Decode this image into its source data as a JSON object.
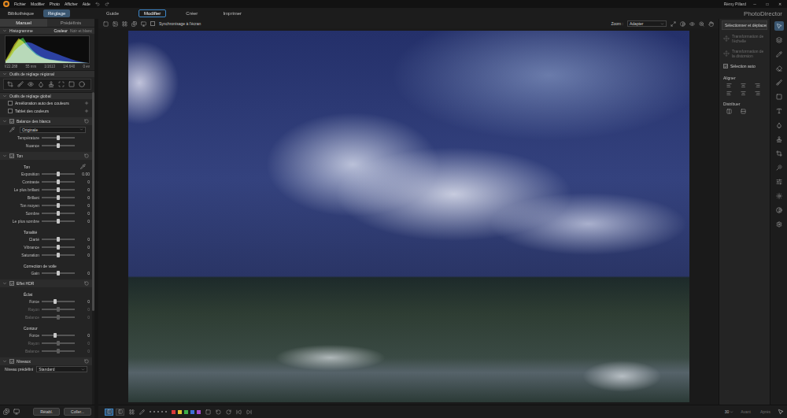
{
  "menu": {
    "items": [
      "Fichier",
      "Modifier",
      "Photo",
      "Afficher",
      "Aide"
    ],
    "user": "Rémy Pillard",
    "windowControls": [
      "─",
      "□",
      "✕"
    ]
  },
  "modeTabs": [
    {
      "label": "Bibliothèque",
      "selected": false
    },
    {
      "label": "Réglage",
      "selected": true
    }
  ],
  "workTabs": [
    {
      "label": "Guide",
      "selected": false
    },
    {
      "label": "Modifier",
      "selected": true
    },
    {
      "label": "Créer",
      "selected": false
    },
    {
      "label": "Imprimer",
      "selected": false
    }
  ],
  "appName": "PhotoDirector",
  "leftPanel": {
    "tabs": [
      {
        "label": "Manuel",
        "selected": true
      },
      {
        "label": "Prédéfinis",
        "selected": false
      }
    ],
    "histogram": {
      "title": "Histogramme",
      "expanded": true,
      "modes": [
        {
          "label": "Couleur",
          "selected": true
        },
        {
          "label": "Noir et blanc",
          "selected": false
        }
      ],
      "series": [
        {
          "name": "red",
          "color": "#d8d020",
          "values": [
            10,
            40,
            70,
            92,
            80,
            60,
            45,
            30,
            22,
            16,
            12,
            10,
            8,
            6,
            5,
            4,
            3,
            2,
            1,
            0
          ]
        },
        {
          "name": "green",
          "color": "#3cc040",
          "values": [
            8,
            30,
            60,
            85,
            95,
            70,
            50,
            35,
            25,
            18,
            14,
            11,
            9,
            7,
            5,
            4,
            3,
            2,
            1,
            0
          ]
        },
        {
          "name": "blue",
          "color": "#3050e0",
          "values": [
            5,
            20,
            45,
            60,
            72,
            78,
            74,
            66,
            58,
            50,
            44,
            38,
            32,
            26,
            20,
            14,
            9,
            5,
            2,
            0
          ]
        }
      ],
      "info": [
        "f/22.288",
        "55 mm",
        "1/1613",
        "1/4.640",
        "0 ev"
      ]
    },
    "regional": {
      "title": "Outils de réglage régional",
      "expanded": true
    },
    "items": [
      {
        "kind": "section",
        "label": "Outils de réglage global",
        "expanded": true
      },
      {
        "kind": "action",
        "label": "Amélioration auto des couleurs",
        "checked": false
      },
      {
        "kind": "action",
        "label": "Tablet des couleurs",
        "checked": false
      },
      {
        "kind": "group",
        "label": "Balance des blancs",
        "checked": true,
        "expanded": true
      },
      {
        "kind": "preset",
        "value": "Originale"
      },
      {
        "kind": "slider",
        "label": "Température",
        "level": 0.5,
        "disabled": false
      },
      {
        "kind": "slider",
        "label": "Nuance",
        "level": 0.5,
        "disabled": false
      },
      {
        "kind": "group",
        "label": "Ton",
        "checked": true,
        "expanded": true
      },
      {
        "kind": "subhead",
        "label": "Ton",
        "picker": true
      },
      {
        "kind": "slider",
        "label": "Exposition",
        "value": "0.00",
        "level": 0.5,
        "disabled": false
      },
      {
        "kind": "slider",
        "label": "Contraste",
        "value": "0",
        "level": 0.5,
        "disabled": false
      },
      {
        "kind": "slider",
        "label": "Le plus brillant",
        "value": "0",
        "level": 0.5,
        "disabled": false
      },
      {
        "kind": "slider",
        "label": "Brillant",
        "value": "0",
        "level": 0.5,
        "disabled": false
      },
      {
        "kind": "slider",
        "label": "Ton moyen",
        "value": "0",
        "level": 0.5,
        "disabled": false
      },
      {
        "kind": "slider",
        "label": "Sombre",
        "value": "0",
        "level": 0.5,
        "disabled": false
      },
      {
        "kind": "slider",
        "label": "Le plus sombre",
        "value": "0",
        "level": 0.5,
        "disabled": false
      },
      {
        "kind": "subhead",
        "label": "Tonalité",
        "picker": false
      },
      {
        "kind": "slider",
        "label": "Clarté",
        "value": "0",
        "level": 0.5,
        "disabled": false
      },
      {
        "kind": "slider",
        "label": "Vibrance",
        "value": "0",
        "level": 0.5,
        "disabled": false
      },
      {
        "kind": "slider",
        "label": "Saturation",
        "value": "0",
        "level": 0.5,
        "disabled": false
      },
      {
        "kind": "subhead",
        "label": "Correction de voile",
        "picker": false
      },
      {
        "kind": "slider",
        "label": "Gain",
        "value": "0",
        "level": 0.5,
        "disabled": false
      },
      {
        "kind": "group",
        "label": "Effet HDR",
        "checked": true,
        "expanded": true
      },
      {
        "kind": "subhead",
        "label": "Éclat",
        "picker": false
      },
      {
        "kind": "slider",
        "label": "Force",
        "value": "0",
        "level": 0.4,
        "disabled": false
      },
      {
        "kind": "slider",
        "label": "Rayon",
        "value": "0",
        "level": 0.5,
        "disabled": true
      },
      {
        "kind": "slider",
        "label": "Balance",
        "value": "0",
        "level": 0.5,
        "disabled": true
      },
      {
        "kind": "subhead",
        "label": "Contour",
        "picker": false
      },
      {
        "kind": "slider",
        "label": "Force",
        "value": "0",
        "level": 0.4,
        "disabled": false
      },
      {
        "kind": "slider",
        "label": "Rayon",
        "value": "0",
        "level": 0.5,
        "disabled": true
      },
      {
        "kind": "slider",
        "label": "Balance",
        "value": "0",
        "level": 0.5,
        "disabled": true
      },
      {
        "kind": "group",
        "label": "Niveaux",
        "checked": true,
        "expanded": true
      },
      {
        "kind": "levelpreset",
        "label": "Niveau prédéfini",
        "value": "Standard"
      }
    ],
    "footer": {
      "buttons": [
        "Rétabl.",
        "Coller..."
      ]
    }
  },
  "viewToolbar": {
    "sync": {
      "label": "Synchronisage à l'écran",
      "checked": false
    },
    "zoomLabel": "Zoom :",
    "zoomValue": "Adapter"
  },
  "rightPanel": {
    "title": "Sélectionner et déplacer",
    "tools": [
      {
        "label": "Transformation de l'échelle",
        "disabled": true
      },
      {
        "label": "Transformation de la distorsion",
        "disabled": true
      }
    ],
    "autoSelect": {
      "label": "Sélection auto",
      "checked": true
    },
    "align": "Aligner",
    "distribute": "Distribuer"
  },
  "toolColumn": {
    "selectedIndex": 0
  },
  "bottomBar": {
    "viewModes": [
      {
        "selected": true
      },
      {
        "selected": false
      }
    ],
    "rating": {
      "stars": 0,
      "max": 5
    },
    "colorLabels": [
      {
        "color": "#d93a3a",
        "selected": false
      },
      {
        "color": "#e0c030",
        "selected": false
      },
      {
        "color": "#3fae49",
        "selected": false
      },
      {
        "color": "#3d6fd6",
        "selected": false
      },
      {
        "color": "#a24ac8",
        "selected": false
      }
    ],
    "thumbSize": "30",
    "compare": [
      {
        "label": "Avant",
        "disabled": true
      },
      {
        "label": "Après",
        "disabled": true
      }
    ]
  }
}
